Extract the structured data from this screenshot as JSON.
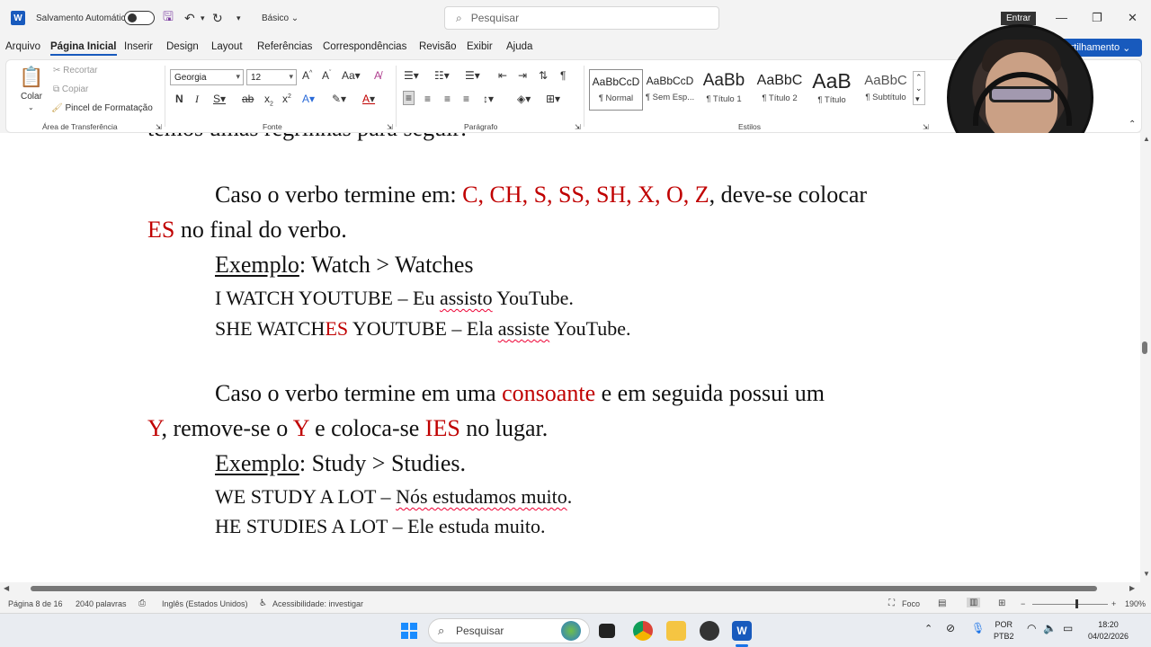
{
  "titlebar": {
    "autosave_label": "Salvamento Automático",
    "style_name": "Básico",
    "search_placeholder": "Pesquisar",
    "signin": "Entrar"
  },
  "menu": [
    "Arquivo",
    "Página Inicial",
    "Inserir",
    "Design",
    "Layout",
    "Referências",
    "Correspondências",
    "Revisão",
    "Exibir",
    "Ajuda"
  ],
  "share_label": "rtilhamento",
  "ribbon": {
    "clipboard": {
      "paste": "Colar",
      "cut": "Recortar",
      "copy": "Copiar",
      "format_painter": "Pincel de Formatação",
      "label": "Área de Transferência"
    },
    "font": {
      "family": "Georgia",
      "size": "12",
      "label": "Fonte"
    },
    "paragraph": {
      "label": "Parágrafo"
    },
    "styles": {
      "label": "Estilos",
      "items": [
        {
          "sample": "AaBbCcD",
          "name": "¶ Normal"
        },
        {
          "sample": "AaBbCcD",
          "name": "¶ Sem Esp..."
        },
        {
          "sample": "AaBb",
          "name": "¶ Título 1"
        },
        {
          "sample": "AaBbC",
          "name": "¶ Título 2"
        },
        {
          "sample": "AaB",
          "name": "¶ Título"
        },
        {
          "sample": "AaBbC",
          "name": "¶ Subtítulo"
        }
      ]
    }
  },
  "document": {
    "top_cut": "temos umas regrinhas para seguir:",
    "r1_a": "Caso o verbo termine em: ",
    "r1_b": "C, CH, S, SS, SH, X, O, Z",
    "r1_c": ", deve-se colocar",
    "r1_d": "ES",
    "r1_e": " no final do verbo.",
    "ex1_label": "Exemplo",
    "ex1_rest": ": Watch > Watches",
    "ex1_l1a": "I WATCH YOUTUBE – Eu ",
    "ex1_l1b": "assisto",
    "ex1_l1c": " YouTube.",
    "ex1_l2a": "SHE WATCH",
    "ex1_l2b": "ES",
    "ex1_l2c": " YOUTUBE – Ela ",
    "ex1_l2d": "assiste",
    "ex1_l2e": " YouTube.",
    "r2_a": "Caso o verbo termine em uma ",
    "r2_b": "consoante",
    "r2_c": " e em seguida possui um",
    "r2_d": "Y",
    "r2_e": ", remove-se o ",
    "r2_f": "Y",
    "r2_g": " e coloca-se ",
    "r2_h": "IES",
    "r2_i": " no lugar.",
    "ex2_label": "Exemplo",
    "ex2_rest": ": Study > Studies.",
    "ex2_l1a": "WE STUDY A LOT – ",
    "ex2_l1b": "Nós estudamos muito",
    "ex2_l1c": ".",
    "ex2_l2": "HE STUDIES A LOT – Ele estuda muito."
  },
  "status": {
    "page": "Página 8 de 16",
    "words": "2040 palavras",
    "language": "Inglês (Estados Unidos)",
    "accessibility": "Acessibilidade: investigar",
    "focus": "Foco",
    "zoom": "190%"
  },
  "taskbar": {
    "search": "Pesquisar",
    "lang1": "POR",
    "lang2": "PTB2",
    "time": "18:20",
    "date": "04/02/2026"
  },
  "colors": {
    "accent": "#185abd",
    "red_text": "#c00000"
  }
}
